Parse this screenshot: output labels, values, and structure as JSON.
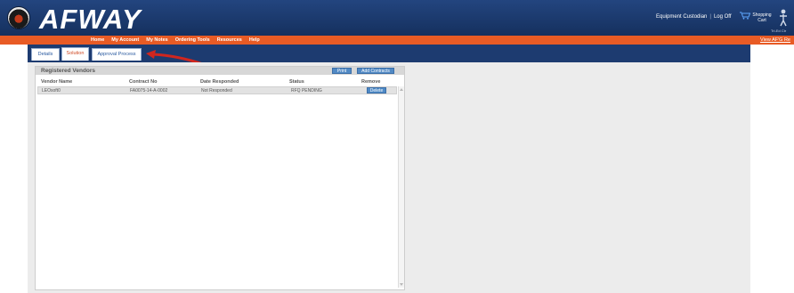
{
  "app": {
    "logo_text": "AFWAY"
  },
  "header": {
    "user_links": [
      "Equipment Custodian",
      "Log Off"
    ],
    "cart_label": "Shopping Cart",
    "tiny_label": "Tri-Ed Ctr"
  },
  "nav": {
    "items": [
      "Home",
      "My Account",
      "My Notes",
      "Ordering Tools",
      "Resources",
      "Help"
    ],
    "right_link": "View AF'G Re"
  },
  "tabs": [
    {
      "label": "Details",
      "active": false
    },
    {
      "label": "Solution",
      "active": true
    },
    {
      "label": "Approval Process",
      "active": false
    }
  ],
  "panel": {
    "title": "Registered Vendors",
    "buttons": {
      "print": "Print",
      "add": "Add Contracts"
    },
    "columns": [
      "Vendor Name",
      "Contract No",
      "Date Responded",
      "Status",
      "Remove"
    ],
    "rows": [
      {
        "vendor": "LEOsoft0",
        "contract": "FA0075-14-A-0002",
        "date": "Not Responded",
        "status": "RFQ PENDING",
        "remove_label": "Delete"
      }
    ]
  },
  "colors": {
    "header_blue": "#1d3b70",
    "nav_orange": "#e85b25",
    "button_blue": "#4f8ac6",
    "arrow_red": "#d0261f"
  },
  "icons": {
    "cart": "shopping-cart-icon",
    "helper": "helper-figure-icon",
    "logo": "afway-seal-icon"
  }
}
